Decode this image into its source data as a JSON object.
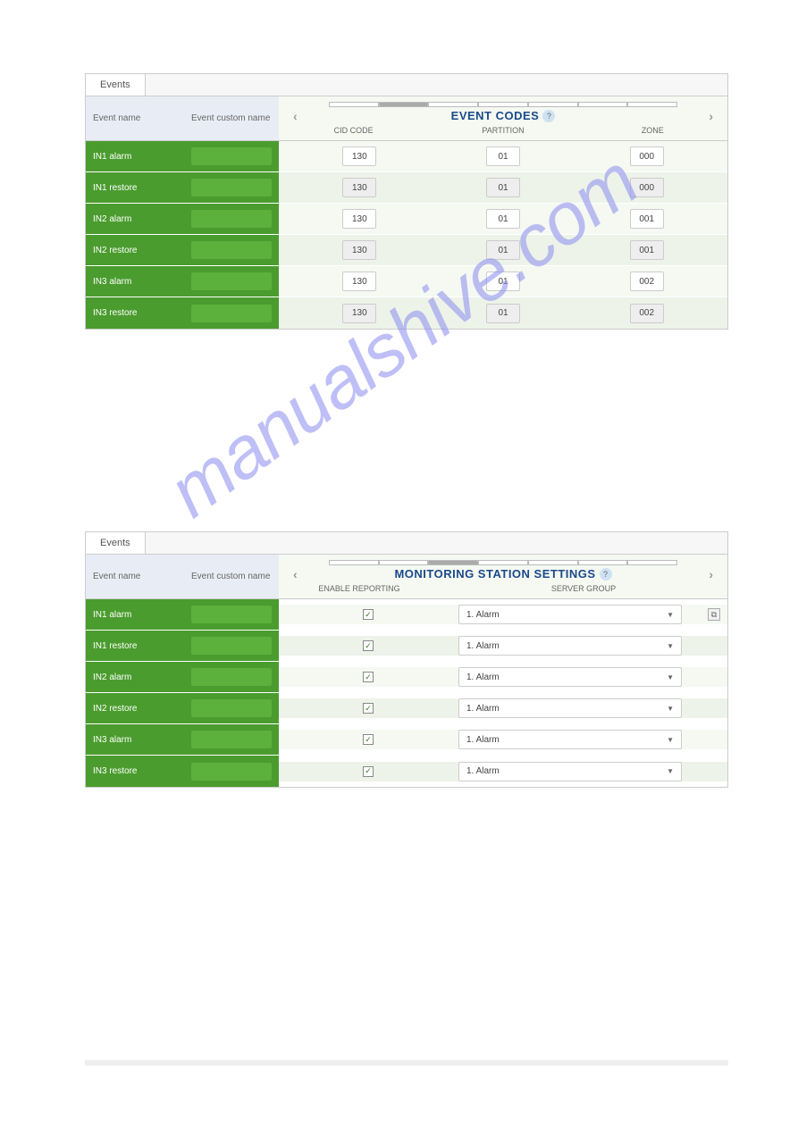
{
  "watermark_text": "manualshive.com",
  "panel1": {
    "tab_label": "Events",
    "left_header": {
      "col1": "Event name",
      "col2": "Event custom name"
    },
    "title": "EVENT CODES",
    "help": "?",
    "sub_headers": {
      "cid": "CID CODE",
      "partition": "PARTITION",
      "zone": "ZONE"
    },
    "rows": [
      {
        "name": "IN1 alarm",
        "cid": "130",
        "partition": "01",
        "zone": "000",
        "grey": false
      },
      {
        "name": "IN1 restore",
        "cid": "130",
        "partition": "01",
        "zone": "000",
        "grey": true
      },
      {
        "name": "IN2 alarm",
        "cid": "130",
        "partition": "01",
        "zone": "001",
        "grey": false
      },
      {
        "name": "IN2 restore",
        "cid": "130",
        "partition": "01",
        "zone": "001",
        "grey": true
      },
      {
        "name": "IN3 alarm",
        "cid": "130",
        "partition": "01",
        "zone": "002",
        "grey": false
      },
      {
        "name": "IN3 restore",
        "cid": "130",
        "partition": "01",
        "zone": "002",
        "grey": true
      }
    ]
  },
  "panel2": {
    "tab_label": "Events",
    "left_header": {
      "col1": "Event name",
      "col2": "Event custom name"
    },
    "title": "MONITORING STATION SETTINGS",
    "help": "?",
    "sub_headers": {
      "enable": "ENABLE REPORTING",
      "group": "SERVER GROUP"
    },
    "rows": [
      {
        "name": "IN1 alarm",
        "checked": true,
        "group": "1. Alarm",
        "copy": true
      },
      {
        "name": "IN1 restore",
        "checked": true,
        "group": "1. Alarm",
        "copy": false
      },
      {
        "name": "IN2 alarm",
        "checked": true,
        "group": "1. Alarm",
        "copy": false
      },
      {
        "name": "IN2 restore",
        "checked": true,
        "group": "1. Alarm",
        "copy": false
      },
      {
        "name": "IN3 alarm",
        "checked": true,
        "group": "1. Alarm",
        "copy": false
      },
      {
        "name": "IN3 restore",
        "checked": true,
        "group": "1. Alarm",
        "copy": false
      }
    ]
  }
}
